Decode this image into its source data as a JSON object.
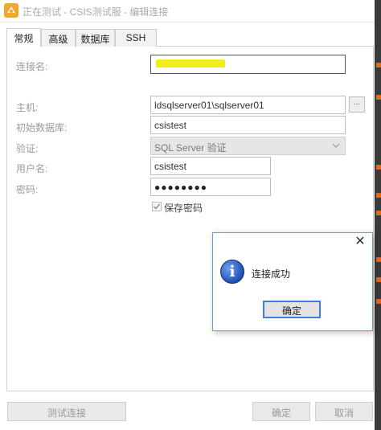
{
  "window": {
    "title": "正在测试 - CSIS测试服 - 编辑连接"
  },
  "tabs": [
    {
      "label": "常规"
    },
    {
      "label": "高级"
    },
    {
      "label": "数据库"
    },
    {
      "label": "SSH"
    }
  ],
  "form": {
    "connection_name_label": "连接名:",
    "host_label": "主机:",
    "host_value": "ldsqlserver01\\sqlserver01",
    "host_browse_label": "...",
    "initial_db_label": "初始数据库:",
    "initial_db_value": "csistest",
    "auth_label": "验证:",
    "auth_value": "SQL Server 验证",
    "username_label": "用户名:",
    "username_value": "csistest",
    "password_label": "密码:",
    "password_value": "●●●●●●●●",
    "save_password_label": "保存密码",
    "save_password_checked": true
  },
  "footer": {
    "test_button": "测试连接",
    "ok_button": "确定",
    "cancel_button": "取消"
  },
  "dialog": {
    "message": "连接成功",
    "ok_button": "确定",
    "close_glyph": "✕"
  },
  "colors": {
    "dialog_border": "#6a9bd8",
    "ok_focus": "#3c7fd4",
    "highlight": "#f2ee1a",
    "app_icon": "#f0a830"
  }
}
